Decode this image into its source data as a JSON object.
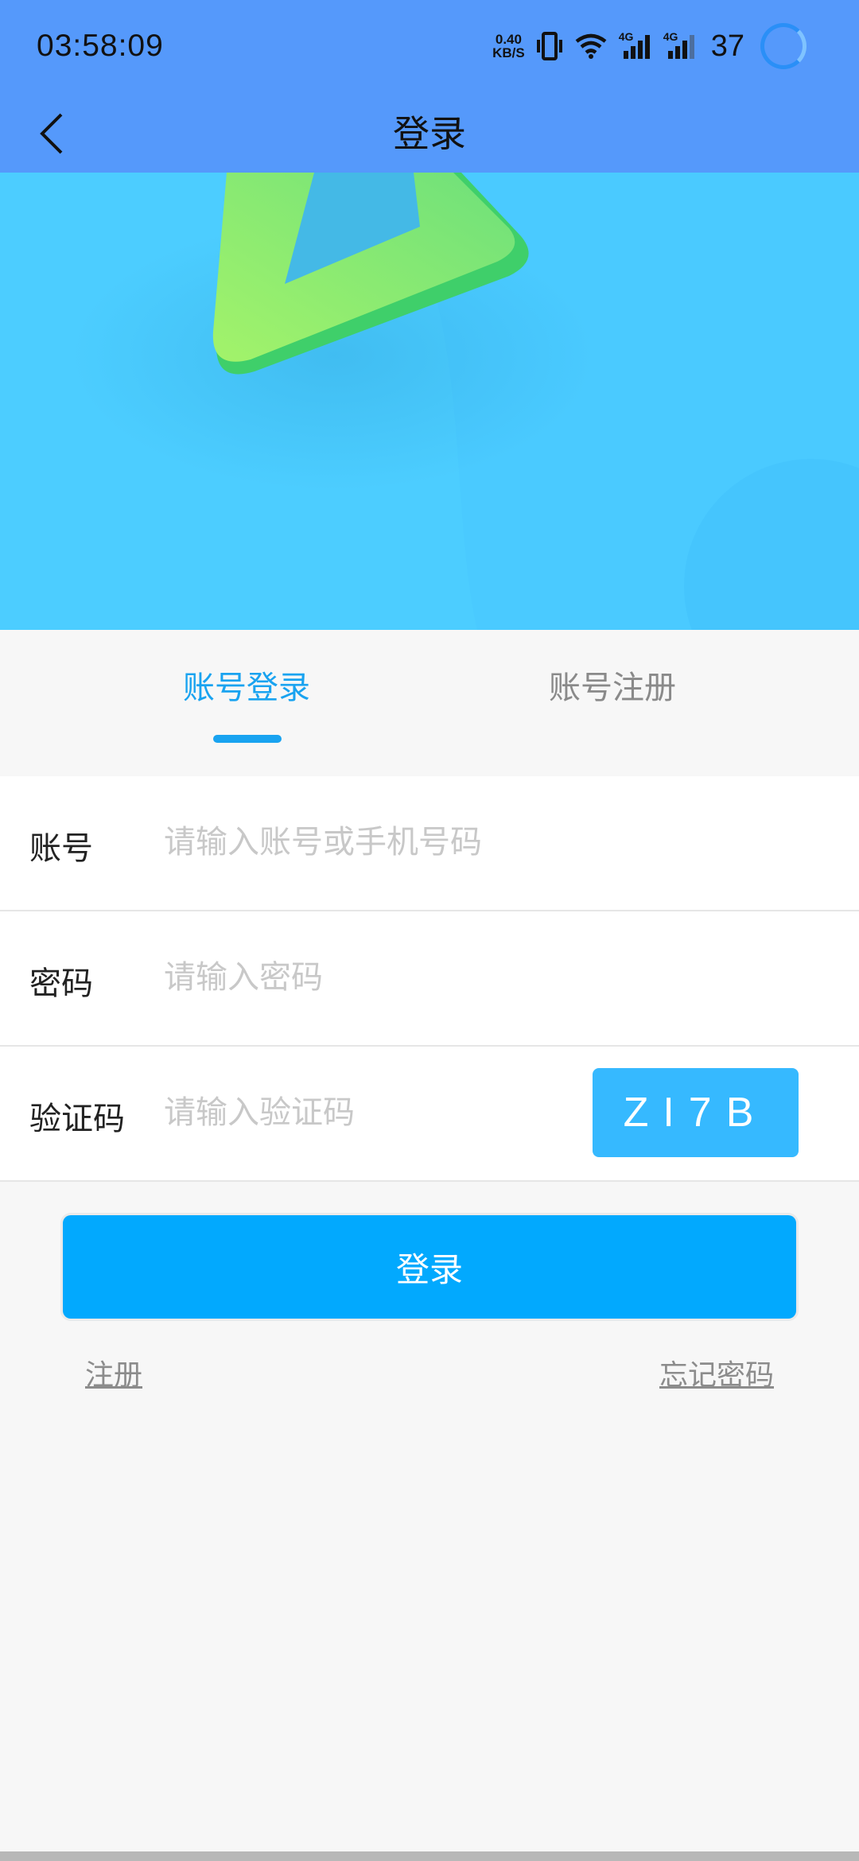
{
  "status_bar": {
    "time": "03:58:09",
    "net_speed_value": "0.40",
    "net_speed_unit": "KB/S",
    "signal_1_label": "4G",
    "signal_2_label": "4G",
    "battery": "37"
  },
  "header": {
    "title": "登录",
    "back_icon": "chevron-left-icon"
  },
  "tabs": {
    "login": "账号登录",
    "register": "账号注册",
    "active": "login"
  },
  "form": {
    "account_label": "账号",
    "account_placeholder": "请输入账号或手机号码",
    "password_label": "密码",
    "password_placeholder": "请输入密码",
    "captcha_label": "验证码",
    "captcha_placeholder": "请输入验证码",
    "captcha_code": "ZI7B"
  },
  "actions": {
    "login_button": "登录",
    "register_link": "注册",
    "forgot_link": "忘记密码"
  },
  "colors": {
    "header_bg": "#5599fb",
    "accent": "#19a3f0",
    "button": "#02a9fe",
    "banner_bg": "#4ccdff"
  }
}
